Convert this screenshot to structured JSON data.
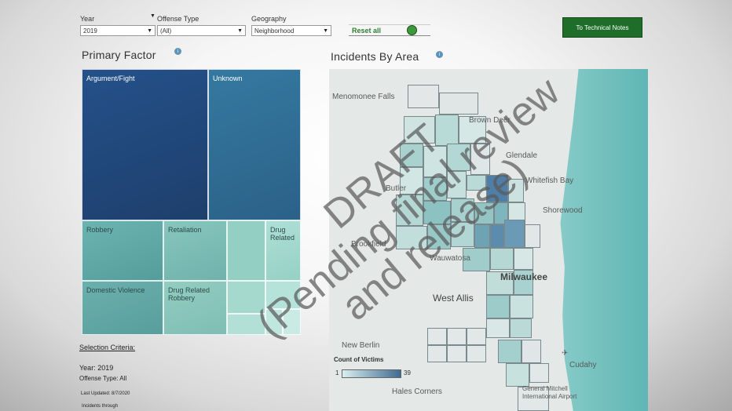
{
  "filters": {
    "year": {
      "label": "Year",
      "value": "2019"
    },
    "offense_type": {
      "label": "Offense Type",
      "value": "(All)"
    },
    "geography": {
      "label": "Geography",
      "value": "Neighborhood"
    },
    "reset_label": "Reset all",
    "tech_notes_label": "To Technical Notes"
  },
  "primary_factor": {
    "title": "Primary Factor",
    "cells": [
      {
        "label": "Argument/Fight",
        "color": "#234a78"
      },
      {
        "label": "Unknown",
        "color": "#2f6a93"
      },
      {
        "label": "Robbery",
        "color": "#5fa7a6"
      },
      {
        "label": "Retaliation",
        "color": "#79bdb5"
      },
      {
        "label": "Drug Related",
        "color": "#9fd3c8"
      },
      {
        "label": "Domestic Violence",
        "color": "#5d9e9e"
      },
      {
        "label": "Drug Related Robbery",
        "color": "#8ccabe"
      }
    ]
  },
  "incidents_by_area": {
    "title": "Incidents By Area",
    "places": [
      "Menomonee Falls",
      "Brown Deer",
      "Glendale",
      "Whitefish Bay",
      "Shorewood",
      "Butler",
      "Brookfield",
      "Wauwatosa",
      "Milwaukee",
      "West Allis",
      "New Berlin",
      "Cudahy",
      "Hales Corners",
      "General Mitchell International Airport"
    ],
    "legend": {
      "title": "Count of Victims",
      "min": "1",
      "max": "39",
      "color_low": "#d9eef0",
      "color_high": "#3f6b8f"
    }
  },
  "selection": {
    "heading": "Selection Criteria:",
    "year_label": "Year:",
    "year_value": "2019",
    "offense_label": "Offense Type:",
    "offense_value": "All",
    "last_updated": "Last Updated: 8/7/2020",
    "incidents_through": "Incidents through"
  },
  "watermark": {
    "line1": "DRAFT",
    "line2": "(Pending final review",
    "line3": "and release)"
  }
}
